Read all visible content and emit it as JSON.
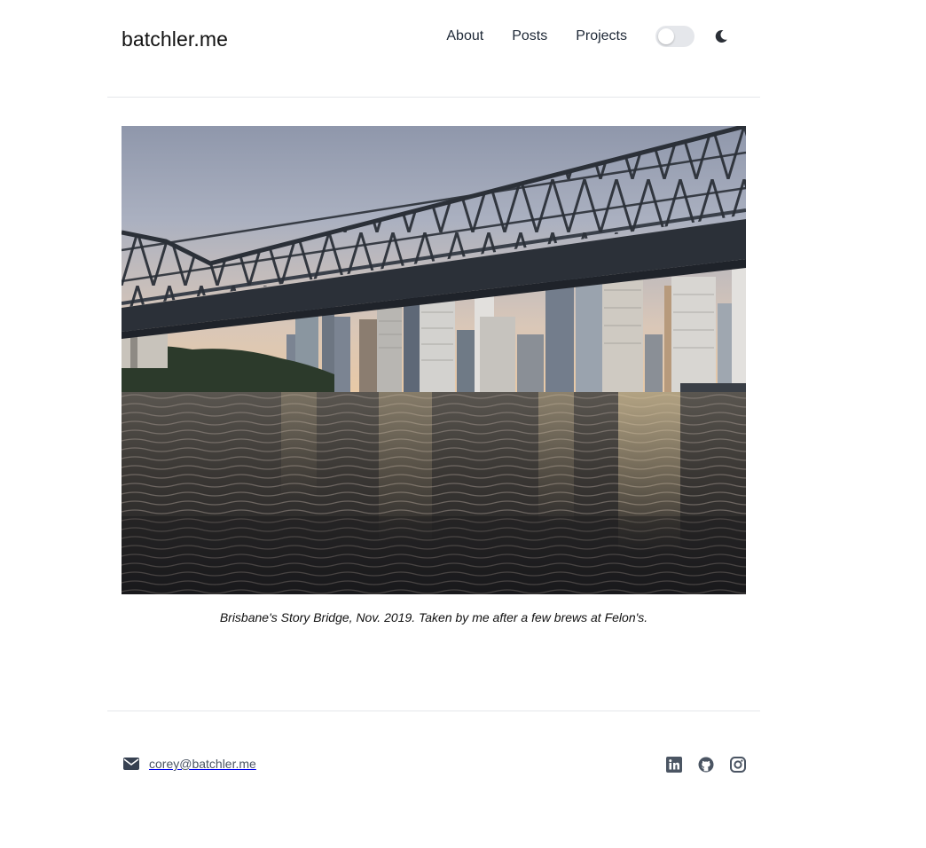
{
  "site": {
    "brand": "batchler.me"
  },
  "nav": {
    "items": [
      {
        "label": "About"
      },
      {
        "label": "Posts"
      },
      {
        "label": "Projects"
      }
    ],
    "theme_toggle_state": "off",
    "theme_icon": "moon-icon"
  },
  "photo": {
    "caption": "Brisbane's Story Bridge, Nov. 2019. Taken by me after a few brews at Felon's."
  },
  "footer": {
    "email": "corey@batchler.me",
    "email_icon": "envelope-icon",
    "social_icons": [
      "linkedin-icon",
      "github-icon",
      "instagram-icon"
    ]
  },
  "colors": {
    "text": "#1f2328",
    "muted": "#4b5563",
    "divider": "#e5e7eb",
    "toggle_track": "#e5e7eb"
  }
}
